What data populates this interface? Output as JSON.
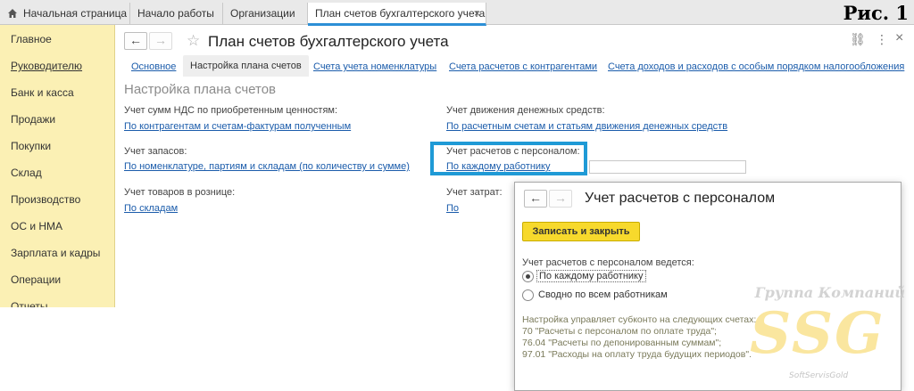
{
  "figure_label": "Рис. 1",
  "tabs": {
    "home": "Начальная страница",
    "start": "Начало работы",
    "orgs": "Организации",
    "active": "План счетов бухгалтерского учета",
    "close_glyph": "×"
  },
  "sidebar": {
    "items": [
      {
        "label": "Главное"
      },
      {
        "label": "Руководителю"
      },
      {
        "label": "Банк и касса"
      },
      {
        "label": "Продажи"
      },
      {
        "label": "Покупки"
      },
      {
        "label": "Склад"
      },
      {
        "label": "Производство"
      },
      {
        "label": "ОС и НМА"
      },
      {
        "label": "Зарплата и кадры"
      },
      {
        "label": "Операции"
      },
      {
        "label": "Отчеты"
      }
    ]
  },
  "header": {
    "title": "План счетов бухгалтерского учета",
    "back_glyph": "←",
    "forward_glyph": "→",
    "star_glyph": "☆",
    "link_glyph": "⛓",
    "more_glyph": "⋮",
    "close_glyph": "×"
  },
  "subtabs": [
    "Основное",
    "Настройка плана счетов",
    "Счета учета номенклатуры",
    "Счета расчетов с контрагентами",
    "Счета доходов и расходов с особым порядком налогообложения"
  ],
  "section_title": "Настройка плана счетов",
  "fields": {
    "vat_label": "Учет сумм НДС по приобретенным ценностям:",
    "vat_value": "По контрагентам и счетам-фактурам полученным",
    "cash_label": "Учет движения денежных средств:",
    "cash_value": "По расчетным счетам и статьям движения денежных средств",
    "stock_label": "Учет запасов:",
    "stock_value": "По номенклатуре, партиям и складам (по количеству и сумме)",
    "staff_label": "Учет расчетов с персоналом:",
    "staff_value": "По каждому работнику",
    "retail_label": "Учет товаров в рознице:",
    "retail_value": "По складам",
    "costs_label": "Учет затрат:",
    "costs_value": "По"
  },
  "modal": {
    "title": "Учет расчетов с персоналом",
    "save_label": "Записать и закрыть",
    "field_label": "Учет расчетов с персоналом ведется:",
    "options": [
      {
        "label": "По каждому работнику",
        "checked": true
      },
      {
        "label": "Сводно по всем работникам",
        "checked": false
      }
    ],
    "notes": [
      "Настройка управляет субконто на следующих счетах:",
      "70 \"Расчеты с персоналом по оплате труда\";",
      "76.04 \"Расчеты по депонированным суммам\";",
      "97.01 \"Расходы на оплату труда будущих периодов\"."
    ]
  },
  "watermark": {
    "group": "Группа Компаний",
    "brand": "SSG",
    "sub": "SoftServisGold"
  },
  "colors": {
    "accent": "#1f9ad6",
    "sidebar_bg": "#fbf0b4",
    "save_button": "#f7d92c",
    "link": "#1b5cab"
  }
}
